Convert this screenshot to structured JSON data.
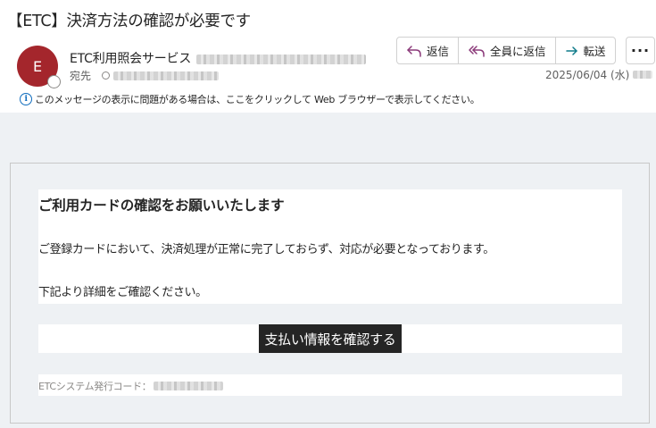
{
  "email": {
    "subject": "【ETC】決済方法の確認が必要です",
    "sender_name": "ETC利用照会サービス",
    "avatar_initial": "E",
    "to_label": "宛先",
    "date": "2025/06/04 (水)",
    "info_notice": "このメッセージの表示に問題がある場合は、ここをクリックして Web ブラウザーで表示してください。"
  },
  "toolbar": {
    "reply_label": "返信",
    "reply_all_label": "全員に返信",
    "forward_label": "転送",
    "more_label": "···"
  },
  "message": {
    "heading": "ご利用カードの確認をお願いいたします",
    "line1": "ご登録カードにおいて、決済処理が正常に完了しておらず、対応が必要となっております。",
    "line2": "下記より詳細をご確認ください。",
    "cta_label": "支払い情報を確認する",
    "code_label": "ETCシステム発行コード："
  },
  "colors": {
    "avatar": "#a4262c",
    "reply_icon": "#8b3a7a",
    "forward_icon": "#0f7b8a",
    "info_icon": "#0f6cbd",
    "body_bg": "#eef1f4",
    "cta_bg": "#252525"
  },
  "icons": [
    "reply-icon",
    "reply-all-icon",
    "forward-icon",
    "info-icon"
  ]
}
